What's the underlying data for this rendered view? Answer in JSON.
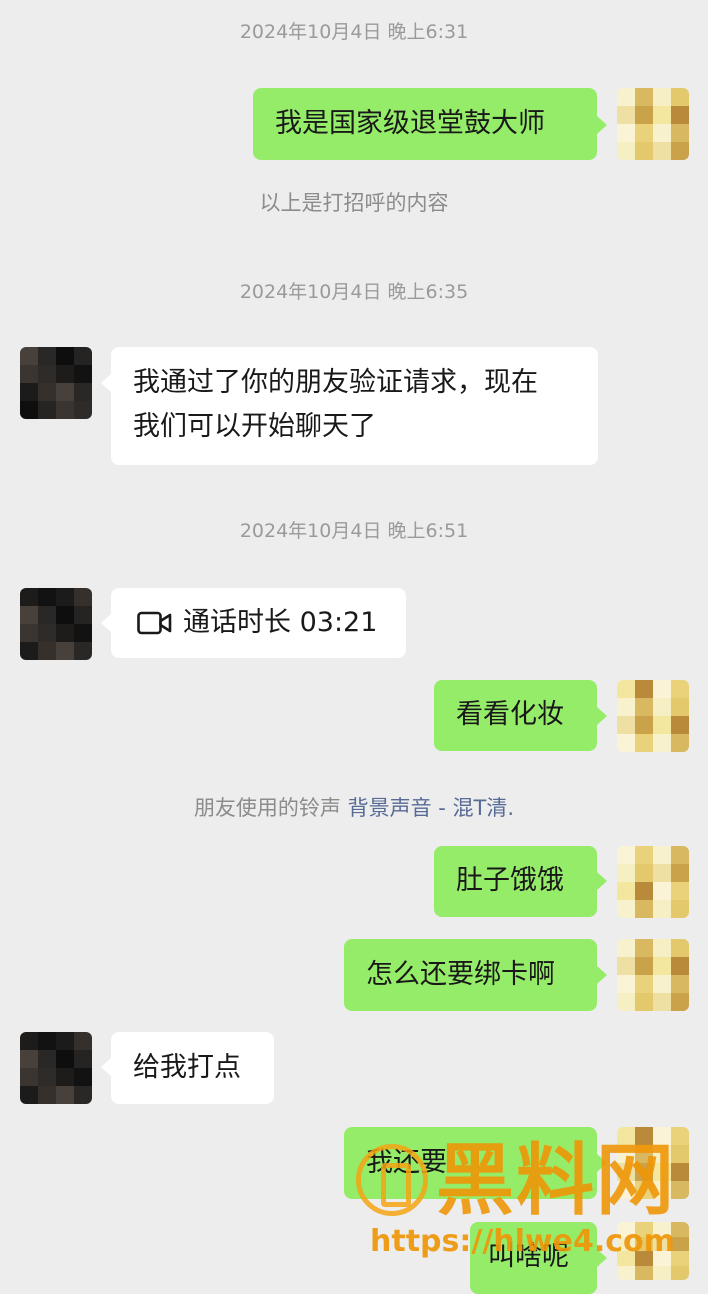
{
  "timestamps": {
    "t1": "2024年10月4日 晚上6:31",
    "t2": "2024年10月4日 晚上6:35",
    "t3": "2024年10月4日 晚上6:51"
  },
  "messages": {
    "m1": "我是国家级退堂鼓大师",
    "m2_line1": "我通过了你的朋友验证请求，现在",
    "m2_line2": "我们可以开始聊天了",
    "m3_call": "通话时长 03:21",
    "m4": "看看化妆",
    "m5": "肚子饿饿",
    "m6": "怎么还要绑卡啊",
    "m7": "给我打点",
    "m8_partial": "我还要",
    "m9": "叫啥呢"
  },
  "system": {
    "greeting_note": "以上是打招呼的内容",
    "ringtone_prefix": "朋友使用的铃声",
    "ringtone_song": "背景声音 - 混T清."
  },
  "icons": {
    "video_call": "video-camera-icon"
  },
  "watermark": {
    "title": "黑料网",
    "url": "https://hlwe4.com"
  },
  "colors": {
    "my_bubble": "#95ec69",
    "their_bubble": "#ffffff",
    "background": "#ededed",
    "link": "#576b95",
    "watermark": "#ee9608"
  }
}
